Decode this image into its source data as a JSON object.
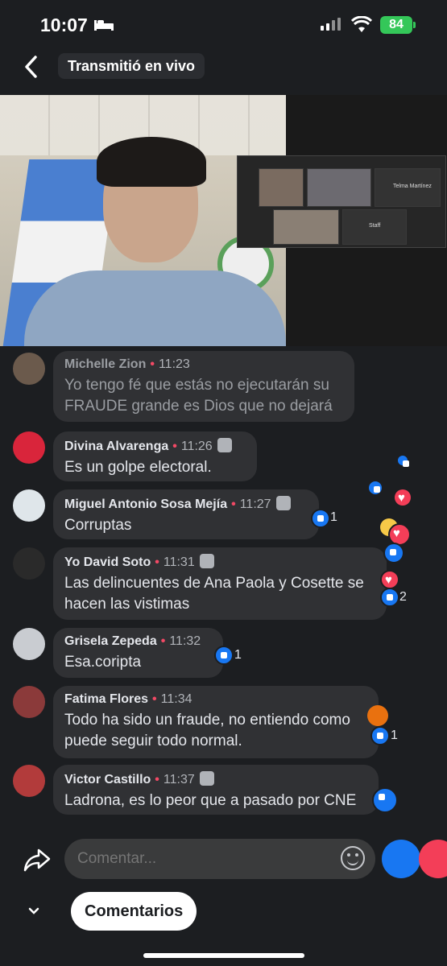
{
  "status_bar": {
    "time": "10:07",
    "battery": "84"
  },
  "header": {
    "title": "Transmitió en vivo"
  },
  "video": {
    "participants": [
      "Telma Martínez",
      "Staff"
    ]
  },
  "comments": [
    {
      "name": "Michelle Zion",
      "time": "11:23",
      "text": "Yo tengo fé que estás no ejecutarán su FRAUDE grande es Dios que no dejará",
      "faded": true
    },
    {
      "name": "Divina Alvarenga",
      "time": "11:26",
      "text": "Es un golpe electoral."
    },
    {
      "name": "Miguel Antonio Sosa Mejía",
      "time": "11:27",
      "text": "Corruptas",
      "reaction_count": "1"
    },
    {
      "name": "Yo David Soto",
      "time": "11:31",
      "text": "Las delincuentes de Ana Paola y Cosette se hacen las vistimas",
      "reaction_count": "2"
    },
    {
      "name": "Grisela Zepeda",
      "time": "11:32",
      "text": "Esa.coripta",
      "reaction_count": "1"
    },
    {
      "name": "Fatima Flores",
      "time": "11:34",
      "text": "Todo ha sido un fraude, no entiendo como puede seguir todo normal.",
      "reaction_count": "1"
    },
    {
      "name": "Victor Castillo",
      "time": "11:37",
      "text": "Ladrona, es lo peor que a pasado por CNE"
    }
  ],
  "composer": {
    "placeholder": "Comentar..."
  },
  "footer": {
    "comments_button": "Comentarios"
  },
  "colors": {
    "accent": "#1877f2",
    "love": "#f33e58",
    "dot": "#f24965"
  }
}
